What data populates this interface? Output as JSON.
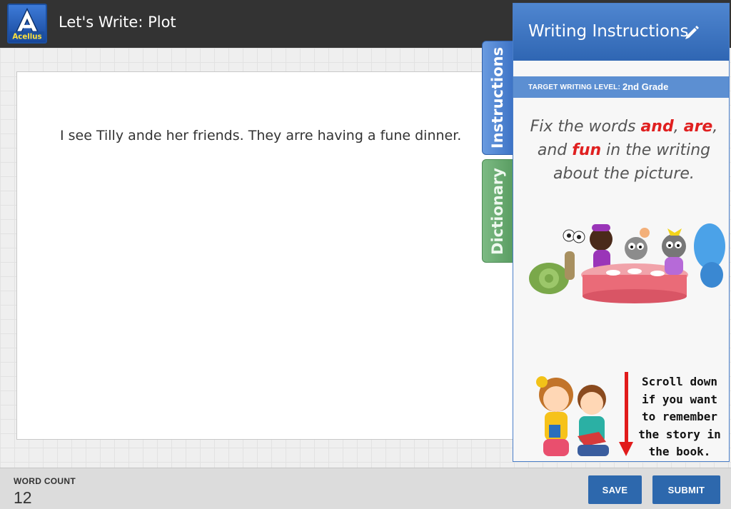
{
  "header": {
    "logo_text": "Acellus",
    "title": "Let's Write: Plot"
  },
  "editor": {
    "text": "I see Tilly ande her friends. They arre having a fune dinner."
  },
  "tabs": [
    {
      "label": "Instructions",
      "active": true
    },
    {
      "label": "Dictionary",
      "active": false
    }
  ],
  "panel": {
    "title": "Writing Instructions",
    "level_label": "TARGET WRITING LEVEL:",
    "level_value": "2nd Grade",
    "instruction": {
      "prefix": "Fix the words ",
      "word1": "and",
      "sep1": ", ",
      "word2": "are",
      "sep2": ", and ",
      "word3": "fun",
      "suffix": " in the writing about the picture."
    },
    "scroll_note": "Scroll down if you want to remember the story in the book."
  },
  "footer": {
    "word_count_label": "WORD COUNT",
    "word_count": "12",
    "save_label": "SAVE",
    "submit_label": "SUBMIT"
  },
  "colors": {
    "header_bg": "#333333",
    "accent_blue": "#2d68ad",
    "highlight_red": "#e02020",
    "dictionary_green": "#5a9d62"
  },
  "icons": [
    "acellus-logo",
    "pencil-icon",
    "red-down-arrow"
  ]
}
